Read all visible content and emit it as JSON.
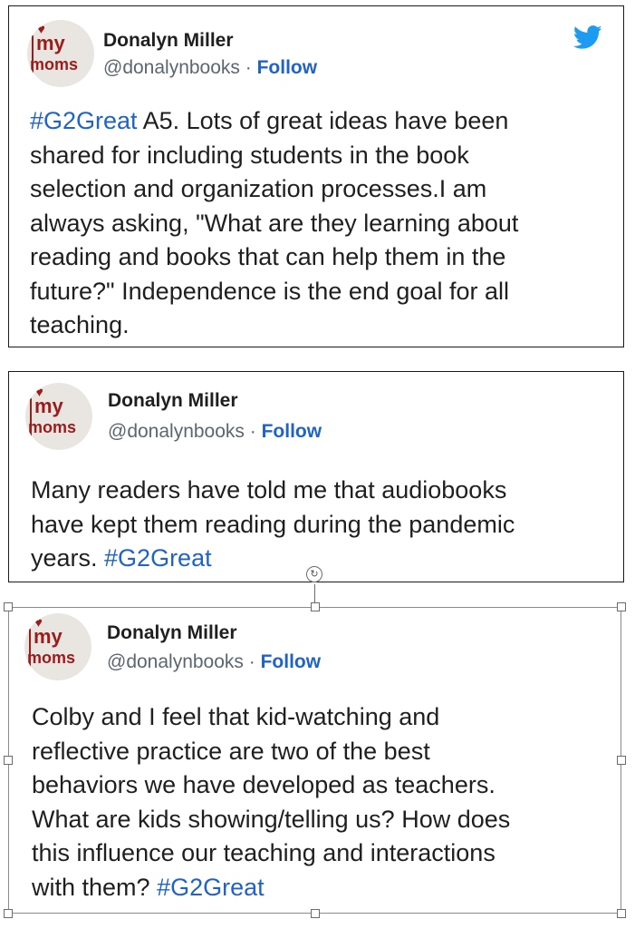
{
  "tweets": [
    {
      "name": "Donalyn Miller",
      "handle": "@donalynbooks",
      "sep": " · ",
      "follow": "Follow",
      "avatar": {
        "w1": "my",
        "w2": "moms"
      },
      "lines": [
        [
          {
            "t": "#G2Great",
            "tag": true
          },
          {
            "t": " A5. Lots of great ideas have been"
          }
        ],
        [
          {
            "t": "shared for including students in the book"
          }
        ],
        [
          {
            "t": "selection and organization processes.I am"
          }
        ],
        [
          {
            "t": "always asking, \"What are they learning about"
          }
        ],
        [
          {
            "t": "reading and books that can help them in the"
          }
        ],
        [
          {
            "t": "future?\" Independence is the end goal for all"
          }
        ],
        [
          {
            "t": "teaching."
          }
        ]
      ]
    },
    {
      "name": "Donalyn Miller",
      "handle": "@donalynbooks",
      "sep": " · ",
      "follow": "Follow",
      "avatar": {
        "w1": "my",
        "w2": "moms"
      },
      "lines": [
        [
          {
            "t": "Many readers have told me that audiobooks"
          }
        ],
        [
          {
            "t": "have kept them reading during the pandemic"
          }
        ],
        [
          {
            "t": "years. "
          },
          {
            "t": "#G2Great",
            "tag": true
          }
        ]
      ]
    },
    {
      "name": "Donalyn Miller",
      "handle": "@donalynbooks",
      "sep": " · ",
      "follow": "Follow",
      "avatar": {
        "w1": "my",
        "w2": "moms"
      },
      "lines": [
        [
          {
            "t": "Colby and I feel that kid-watching and"
          }
        ],
        [
          {
            "t": "reflective practice are two of the best"
          }
        ],
        [
          {
            "t": "behaviors we have developed as teachers."
          }
        ],
        [
          {
            "t": "What are kids showing/telling us? How does"
          }
        ],
        [
          {
            "t": "this influence our teaching and interactions"
          }
        ],
        [
          {
            "t": "with them? "
          },
          {
            "t": "#G2Great",
            "tag": true
          }
        ]
      ]
    }
  ],
  "icons": {
    "bird": "twitter-bird-icon",
    "rotate": "rotate-handle-icon"
  },
  "colors": {
    "link": "#1f63c6",
    "text": "#1f1f1f",
    "muted": "#5b6670",
    "twitter": "#1d9bf0",
    "avatar_text": "#9c1b1b"
  }
}
